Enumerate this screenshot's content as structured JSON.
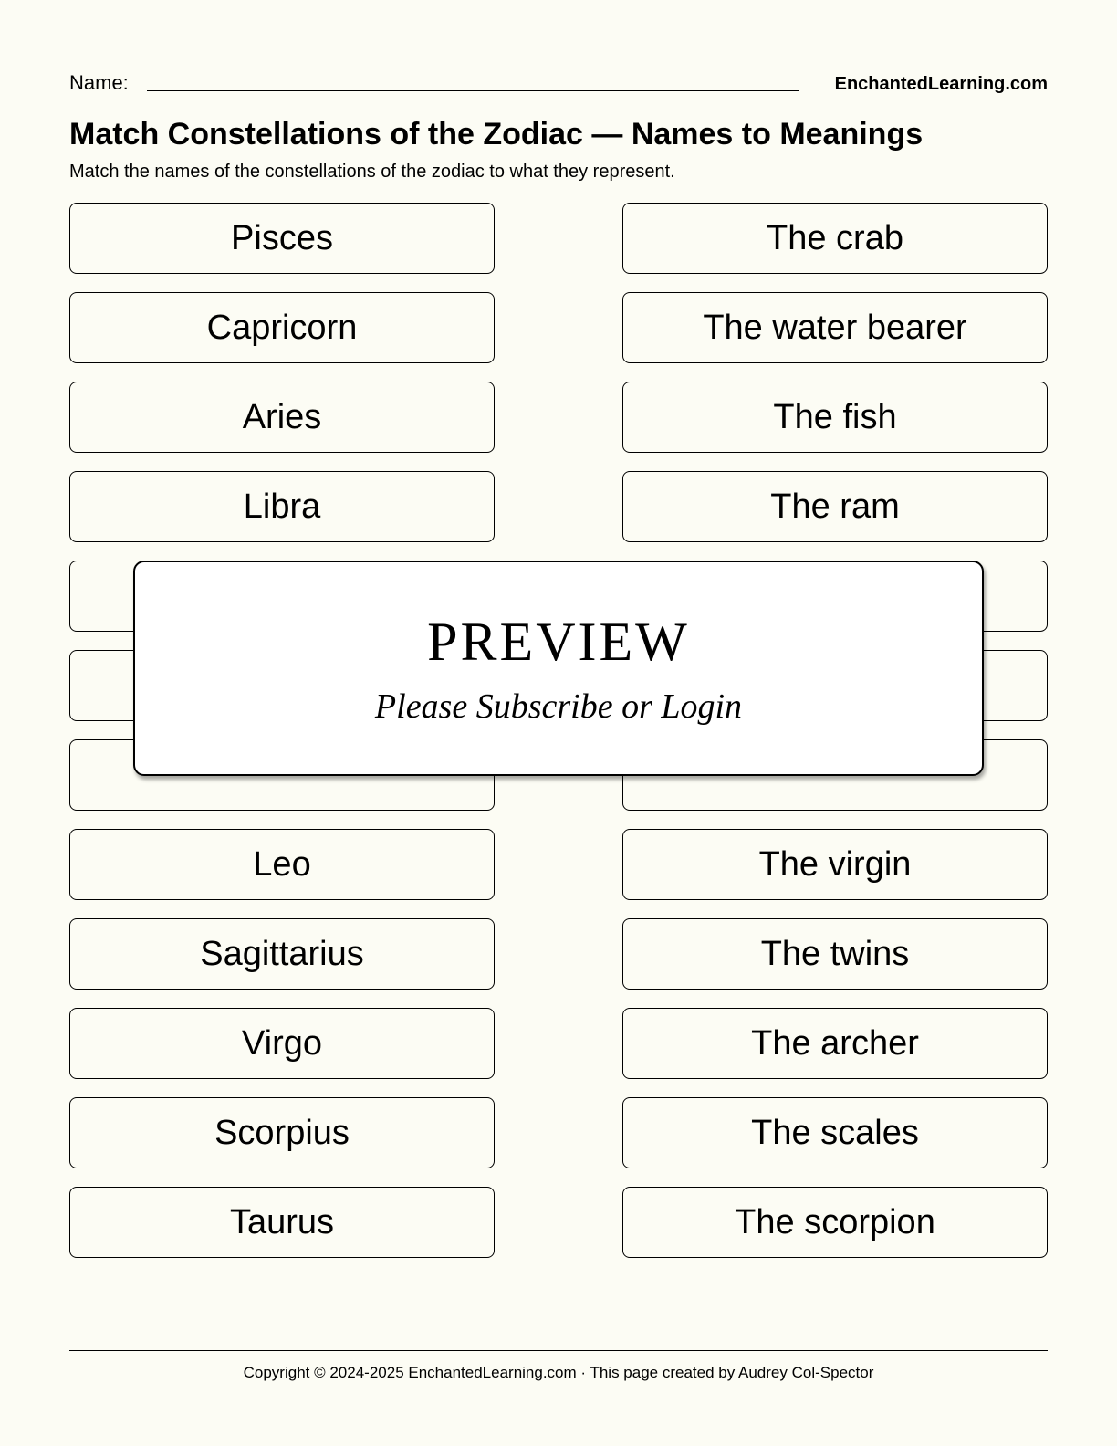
{
  "header": {
    "name_label": "Name:",
    "site": "EnchantedLearning.com"
  },
  "title": "Match Constellations of the Zodiac — Names to Meanings",
  "instructions": "Match the names of the constellations of the zodiac to what they represent.",
  "left": [
    "Pisces",
    "Capricorn",
    "Aries",
    "Libra",
    "",
    "",
    "",
    "Leo",
    "Sagittarius",
    "Virgo",
    "Scorpius",
    "Taurus"
  ],
  "right": [
    "The crab",
    "The water bearer",
    "The fish",
    "The ram",
    "",
    "",
    "",
    "The virgin",
    "The twins",
    "The archer",
    "The scales",
    "The scorpion"
  ],
  "overlay": {
    "title": "PREVIEW",
    "subtitle": "Please Subscribe or Login"
  },
  "footer": "Copyright © 2024-2025 EnchantedLearning.com · This page created by Audrey Col-Spector"
}
